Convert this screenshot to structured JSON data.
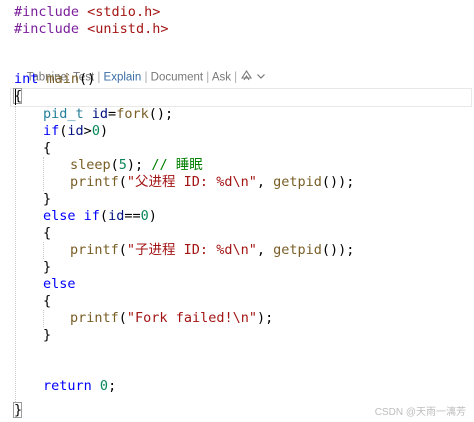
{
  "code": {
    "include1_directive": "#include",
    "include1_file": "<stdio.h>",
    "include2_directive": "#include",
    "include2_file": "<unistd.h>",
    "main_type": "int",
    "main_name": "main",
    "main_parens": "()",
    "open_brace": "{",
    "decl_type": "pid_t",
    "decl_var": "id",
    "decl_eq": "=",
    "decl_fn": "fork",
    "decl_end": "();",
    "if_kw": "if",
    "if_open": "(",
    "if_var": "id",
    "if_op": ">",
    "if_num": "0",
    "if_close": ")",
    "brace_open_1": "{",
    "sleep_fn": "sleep",
    "sleep_open": "(",
    "sleep_num": "5",
    "sleep_close": ");",
    "sleep_comment": "// 睡眠",
    "printf1_fn": "printf",
    "printf1_open": "(",
    "printf1_str": "\"父进程 ID: %d\\n\"",
    "printf1_comma": ", ",
    "printf1_call": "getpid",
    "printf1_end": "());",
    "brace_close_1": "}",
    "elseif_kw1": "else",
    "elseif_kw2": "if",
    "elseif_open": "(",
    "elseif_var": "id",
    "elseif_op": "==",
    "elseif_num": "0",
    "elseif_close": ")",
    "brace_open_2": "{",
    "printf2_fn": "printf",
    "printf2_open": "(",
    "printf2_str": "\"子进程 ID: %d\\n\"",
    "printf2_comma": ", ",
    "printf2_call": "getpid",
    "printf2_end": "());",
    "brace_close_2": "}",
    "else_kw": "else",
    "brace_open_3": "{",
    "printf3_fn": "printf",
    "printf3_open": "(",
    "printf3_str": "\"Fork failed!\\n\"",
    "printf3_end": ");",
    "brace_close_3": "}",
    "return_kw": "return",
    "return_num": "0",
    "return_end": ";",
    "close_brace": "}"
  },
  "codelens": {
    "prefix": "Tabnine: Test",
    "explain": "Explain",
    "document": "Document",
    "ask": "Ask",
    "sep": " | "
  },
  "watermark": "CSDN @天雨一漓芳",
  "colors": {
    "keyword": "#0000ff",
    "preprocessor": "#7a1e9a",
    "string": "#a31515",
    "number": "#098658",
    "function": "#795e26",
    "type": "#267f99",
    "variable": "#001080",
    "comment": "#008000"
  },
  "icons": [
    "tabnine-icon",
    "chevron-down-icon"
  ]
}
